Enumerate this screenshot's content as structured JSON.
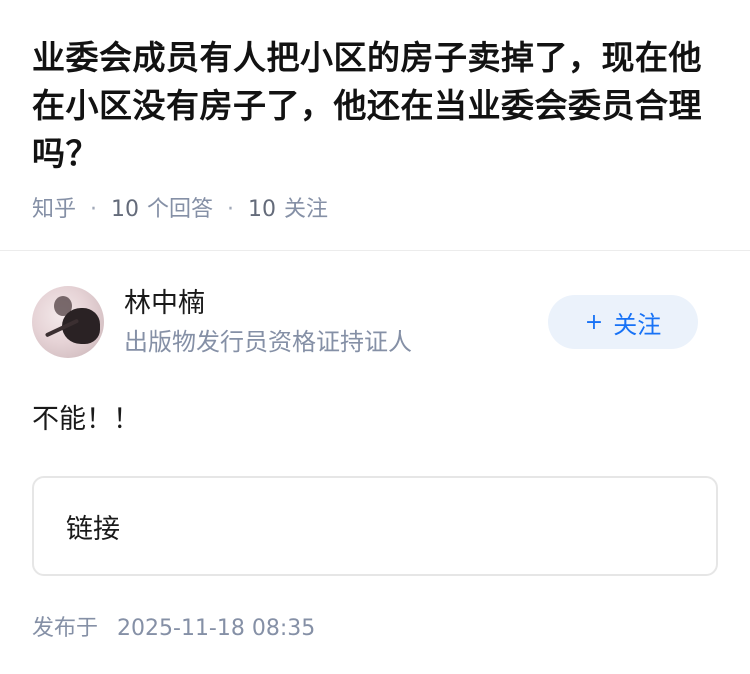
{
  "question": {
    "title": "业委会成员有人把小区的房子卖掉了，现在他在小区没有房子了，他还在当业委会委员合理吗？",
    "source": "知乎",
    "answer_count": "10",
    "answer_label": "个回答",
    "follower_count": "10",
    "follower_label": "关注",
    "separator": "·"
  },
  "answer": {
    "author": {
      "name": "林中楠",
      "bio": "出版物发行员资格证持证人",
      "avatar_icon": "avatar-photo"
    },
    "follow_button": {
      "icon": "plus-icon",
      "plus": "+",
      "label": "关注"
    },
    "content": "不能！！",
    "link_card_label": "链接",
    "published_label": "发布于",
    "published_time": "2025-11-18 08:35"
  },
  "colors": {
    "meta_gray": "#8590a6",
    "follow_blue": "#1772f6",
    "follow_bg": "#ebf2fb"
  }
}
